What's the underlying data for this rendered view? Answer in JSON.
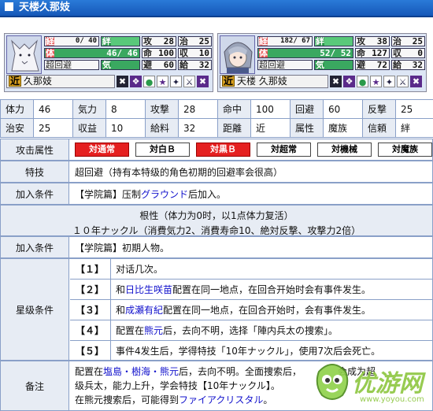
{
  "title": "天楼久那妓",
  "cards": [
    {
      "hp_text": "0/ 40",
      "body_text": "46/ 46",
      "skill_name": "超回避",
      "atk": "28",
      "hit": "100",
      "eva": "60",
      "right_top": "25",
      "right_mid": "10",
      "right_bot": "32",
      "name_prefix": "近",
      "name": "久那妓"
    },
    {
      "hp_text": "182/ 67",
      "body_text": "52/ 52",
      "skill_name": "超回避",
      "atk": "38",
      "hit": "127",
      "eva": "72",
      "right_top": "25",
      "right_mid": "0",
      "right_bot": "32",
      "name_prefix": "近",
      "name": "天楼 久那妓"
    }
  ],
  "card_labels": {
    "jing": "経",
    "ban": "絆",
    "gong": "攻",
    "zhi": "治",
    "ti": "体",
    "ming": "命",
    "shou": "収",
    "qi": "気",
    "bi": "避",
    "gei": "給"
  },
  "stats_rows": [
    [
      {
        "k": "体力",
        "v": "46"
      },
      {
        "k": "気力",
        "v": "8"
      },
      {
        "k": "攻撃",
        "v": "28"
      },
      {
        "k": "命中",
        "v": "100"
      },
      {
        "k": "回避",
        "v": "60"
      },
      {
        "k": "反撃",
        "v": "25"
      }
    ],
    [
      {
        "k": "治安",
        "v": "25"
      },
      {
        "k": "収益",
        "v": "10"
      },
      {
        "k": "給料",
        "v": "32"
      },
      {
        "k": "距離",
        "v": "近"
      },
      {
        "k": "属性",
        "v": "魔族"
      },
      {
        "k": "信頼",
        "v": "絆"
      }
    ]
  ],
  "attack_attr": {
    "label": "攻击属性",
    "buttons": [
      "対通常",
      "対白Ｂ",
      "対黒Ｂ",
      "対超常",
      "対機械",
      "対魔族"
    ]
  },
  "skill": {
    "label": "特技",
    "text": "超回避（持有本特级的角色初期的回避率会很高）"
  },
  "join1": {
    "label": "加入条件",
    "pre": "【学院篇】压制",
    "link": "グラウンド",
    "post": "后加入。"
  },
  "root": {
    "line1": "根性（体力为0时，以1点体力复活）",
    "line2": "１０年ナックル（消費気力2、消費寿命10、絶対反撃、攻撃力2倍）"
  },
  "join2": {
    "label": "加入条件",
    "text": "【学院篇】初期人物。"
  },
  "stars": {
    "label": "星级条件",
    "items": [
      {
        "n": "【１】",
        "pre": "对话几次。",
        "link": "",
        "post": ""
      },
      {
        "n": "【２】",
        "pre": "和",
        "link": "日比生咲苗",
        "post": "配置在同一地点，在回合开始时会有事件发生。"
      },
      {
        "n": "【３】",
        "pre": "和",
        "link": "成瀬有紀",
        "post": "配置在同一地点，在回合开始时，会有事件发生。"
      },
      {
        "n": "【４】",
        "pre": "配置在",
        "link": "熊元",
        "post": "后，去向不明，选择「陣内兵太の捜索」。"
      },
      {
        "n": "【５】",
        "pre": "事件4发生后，学得特技「10年ナックル」，使用7次后会死亡。",
        "link": "",
        "post": ""
      }
    ]
  },
  "notes": {
    "label": "备注",
    "l1_pre": "配置在",
    "l1_link": "塩島・樹海・熊元",
    "l1_post": "后，去向不明。全面捜索后，",
    "l1_tail": "会成为超",
    "l2": "级兵太，能力上升，学会特技【10年ナックル】。",
    "l3_pre": "在熊元捜索后，可能得到",
    "l3_link": "ファイアクリスタル",
    "l3_post": "。"
  },
  "watermark": {
    "big": "优游网",
    "small": "www.yoyou.com"
  },
  "colors": {
    "title_bar": "#1d66c8",
    "active_attr": "#e52020",
    "link": "#1111cc"
  }
}
